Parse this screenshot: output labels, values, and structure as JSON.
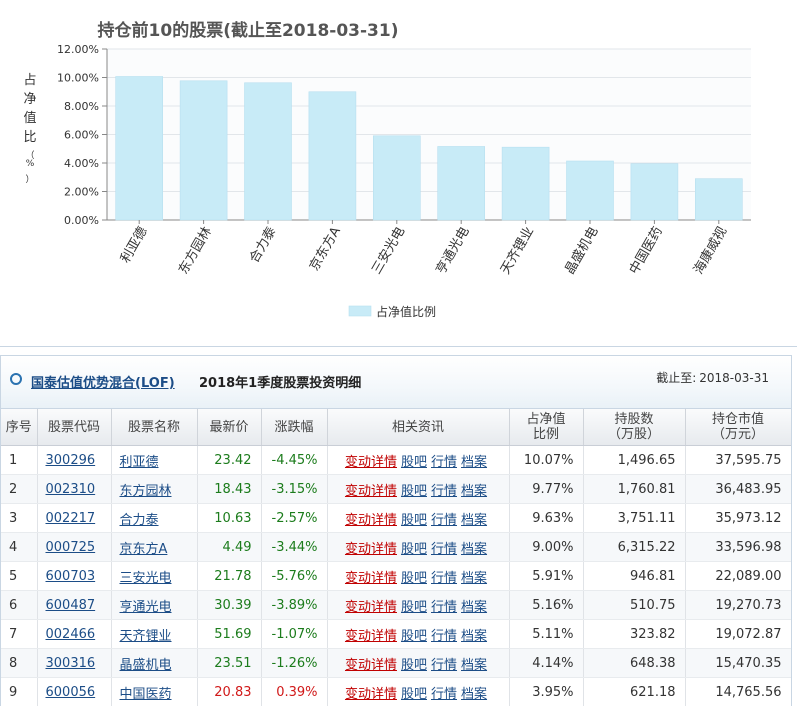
{
  "chart_data": {
    "type": "bar",
    "title": "持仓前10的股票(截止至2018-03-31)",
    "ylabel": "占净值比（%）",
    "xlabel": "",
    "ylim": [
      0,
      12
    ],
    "yticks": [
      "0.00%",
      "2.00%",
      "4.00%",
      "6.00%",
      "8.00%",
      "10.00%",
      "12.00%"
    ],
    "categories": [
      "利亚德",
      "东方园林",
      "合力泰",
      "京东方A",
      "三安光电",
      "亨通光电",
      "天齐锂业",
      "晶盛机电",
      "中国医药",
      "海康威视"
    ],
    "series": [
      {
        "name": "占净值比例",
        "values": [
          10.07,
          9.77,
          9.63,
          9.0,
          5.91,
          5.16,
          5.11,
          4.14,
          3.95,
          2.9
        ]
      }
    ],
    "legend_position": "bottom-center",
    "grid": true,
    "bar_color": "#c8ebf7"
  },
  "panel": {
    "fund_name": "国泰估值优势混合(LOF)",
    "description": "2018年1季度股票投资明细",
    "as_of_label": "截止至:",
    "as_of_date": "2018-03-31"
  },
  "table": {
    "headers": [
      "序号",
      "股票代码",
      "股票名称",
      "最新价",
      "涨跌幅",
      "相关资讯",
      "占净值比例",
      "持股数（万股）",
      "持仓市值（万元）"
    ],
    "header_lines": {
      "ratio": [
        "占净值",
        "比例"
      ],
      "shares": [
        "持股数",
        "（万股）"
      ],
      "value": [
        "持仓市值",
        "（万元）"
      ]
    },
    "link_labels": [
      "变动详情",
      "股吧",
      "行情",
      "档案"
    ],
    "rows": [
      {
        "no": "1",
        "code": "300296",
        "name": "利亚德",
        "price": "23.42",
        "change": "-4.45%",
        "ratio": "10.07%",
        "shares": "1,496.65",
        "value": "37,595.75"
      },
      {
        "no": "2",
        "code": "002310",
        "name": "东方园林",
        "price": "18.43",
        "change": "-3.15%",
        "ratio": "9.77%",
        "shares": "1,760.81",
        "value": "36,483.95"
      },
      {
        "no": "3",
        "code": "002217",
        "name": "合力泰",
        "price": "10.63",
        "change": "-2.57%",
        "ratio": "9.63%",
        "shares": "3,751.11",
        "value": "35,973.12"
      },
      {
        "no": "4",
        "code": "000725",
        "name": "京东方A",
        "price": "4.49",
        "change": "-3.44%",
        "ratio": "9.00%",
        "shares": "6,315.22",
        "value": "33,596.98"
      },
      {
        "no": "5",
        "code": "600703",
        "name": "三安光电",
        "price": "21.78",
        "change": "-5.76%",
        "ratio": "5.91%",
        "shares": "946.81",
        "value": "22,089.00"
      },
      {
        "no": "6",
        "code": "600487",
        "name": "亨通光电",
        "price": "30.39",
        "change": "-3.89%",
        "ratio": "5.16%",
        "shares": "510.75",
        "value": "19,270.73"
      },
      {
        "no": "7",
        "code": "002466",
        "name": "天齐锂业",
        "price": "51.69",
        "change": "-1.07%",
        "ratio": "5.11%",
        "shares": "323.82",
        "value": "19,072.87"
      },
      {
        "no": "8",
        "code": "300316",
        "name": "晶盛机电",
        "price": "23.51",
        "change": "-1.26%",
        "ratio": "4.14%",
        "shares": "648.38",
        "value": "15,470.35"
      },
      {
        "no": "9",
        "code": "600056",
        "name": "中国医药",
        "price": "20.83",
        "change": "0.39%",
        "ratio": "3.95%",
        "shares": "621.18",
        "value": "14,765.56"
      }
    ]
  },
  "colors": {
    "up": "#d11919",
    "down": "#1c7c1c",
    "link": "#1c4d87",
    "news_link": "#c00000"
  }
}
